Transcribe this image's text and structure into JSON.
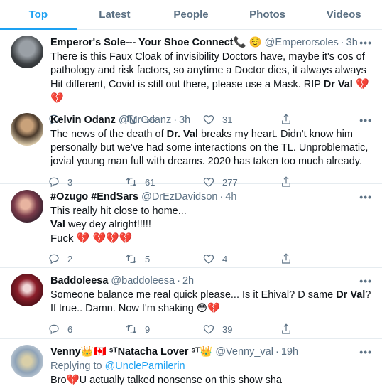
{
  "tabs": [
    {
      "label": "Top",
      "active": true
    },
    {
      "label": "Latest",
      "active": false
    },
    {
      "label": "People",
      "active": false
    },
    {
      "label": "Photos",
      "active": false
    },
    {
      "label": "Videos",
      "active": false
    }
  ],
  "tweets": [
    {
      "name": "Emperor's Sole--- Your Shoe Connect📞 ☺️",
      "handle": "@Emperorsoles",
      "time": "3h",
      "text_parts": [
        "There is this Faux Cloak of invisibility Doctors have, maybe it's cos of pathology and risk factors, so anytime a Doctor dies, it always always Hit different, Covid is still out there, please use a Mask. RIP ",
        "Dr Val",
        " 💔💔"
      ],
      "replies": "",
      "retweets": "56",
      "likes": "31"
    },
    {
      "name": "Kelvin Odanz",
      "handle": "@MrOdanz",
      "time": "3h",
      "text_parts": [
        "The news of the death of ",
        "Dr. Val",
        " breaks my heart. Didn't know him personally but we've had some interactions on the TL. Unproblematic, jovial young man full with dreams. 2020 has taken too much already."
      ],
      "replies": "3",
      "retweets": "61",
      "likes": "277"
    },
    {
      "name": "#Ozugo #EndSars",
      "handle": "@DrEzDavidson",
      "time": "4h",
      "line1": "This really hit close to home...",
      "line2_bold": "Val",
      "line2_rest": " wey dey alright!!!!!",
      "line3": "Fuck 💔 💔💔💔",
      "replies": "2",
      "retweets": "5",
      "likes": "4"
    },
    {
      "name": "Baddoleesa",
      "handle": "@baddoleesa",
      "time": "2h",
      "line1_pre": "Someone balance me real quick please... Is it Ehival? D same ",
      "line1_bold": "Dr Val",
      "line1_post": "?",
      "line2": "If true.. Damn. Now I'm shaking 😳💔",
      "replies": "6",
      "retweets": "9",
      "likes": "39"
    },
    {
      "name": "Venny👑🇨🇦 ˢᵀNatacha Lover ˢᵀ👑",
      "handle": "@Venny_val",
      "time": "19h",
      "replying_prefix": "Replying to ",
      "replying_to": "@UncleParnilerin",
      "text": "Bro💔U actually talked nonsense on this show sha"
    }
  ],
  "more_glyph": "•••",
  "dot": "·"
}
